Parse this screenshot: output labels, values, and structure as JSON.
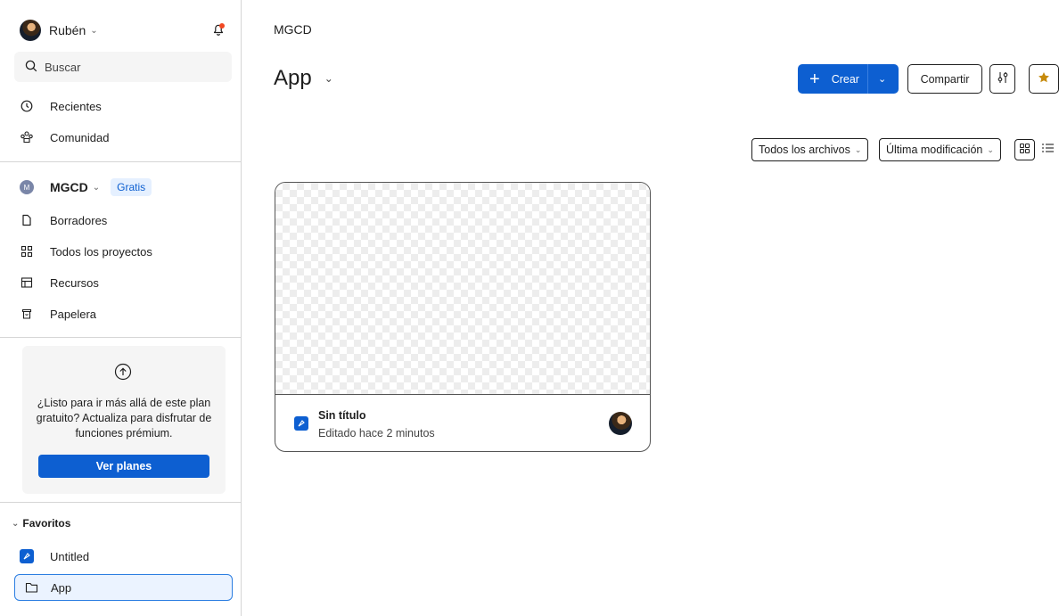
{
  "sidebar": {
    "user_name": "Rubén",
    "search_placeholder": "Buscar",
    "nav": {
      "recent": "Recientes",
      "community": "Comunidad"
    },
    "team": {
      "initial": "M",
      "name": "MGCD",
      "plan_badge": "Gratis"
    },
    "team_nav": {
      "drafts": "Borradores",
      "all_projects": "Todos los proyectos",
      "resources": "Recursos",
      "trash": "Papelera"
    },
    "upgrade": {
      "text": "¿Listo para ir más allá de este plan gratuito? Actualiza para disfrutar de funciones prémium.",
      "button": "Ver planes"
    },
    "favorites": {
      "header": "Favoritos",
      "items": [
        "Untitled",
        "App"
      ]
    }
  },
  "main": {
    "breadcrumb": "MGCD",
    "title": "App",
    "buttons": {
      "create": "Crear",
      "share": "Compartir"
    },
    "filters": {
      "files": "Todos los archivos",
      "sort": "Última modificación"
    },
    "files": [
      {
        "title": "Sin título",
        "subtitle": "Editado hace 2 minutos"
      }
    ]
  },
  "colors": {
    "accent": "#0d5fd1",
    "notification": "#f24822",
    "star": "#c68a0b",
    "selected_bg": "#ebf3ff"
  }
}
